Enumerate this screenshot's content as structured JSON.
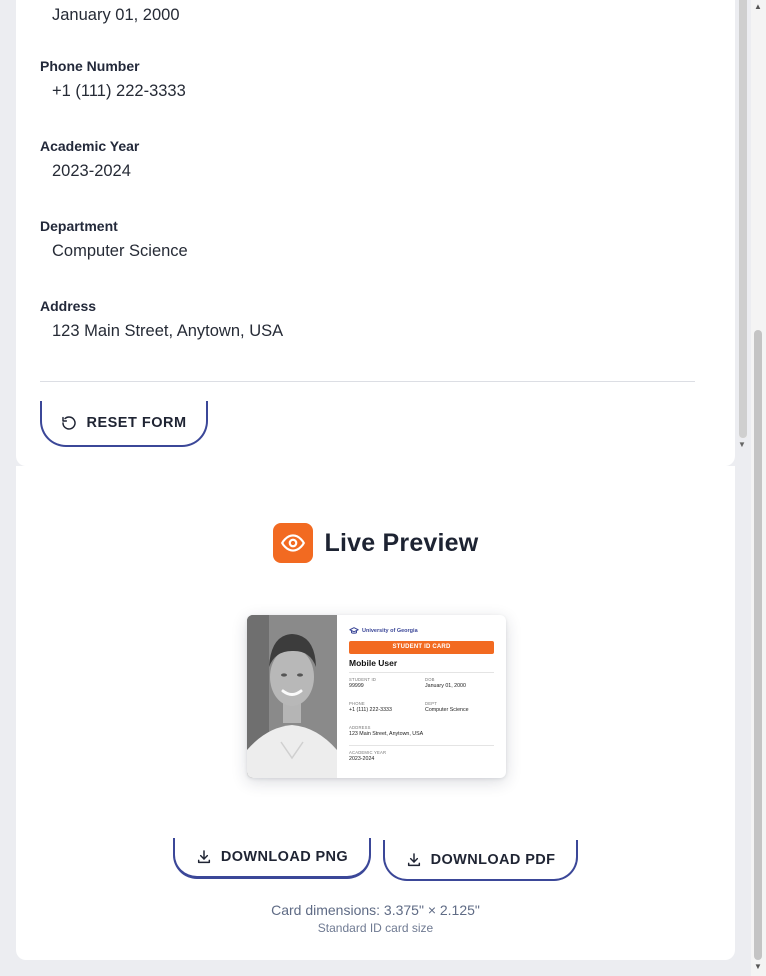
{
  "form": {
    "fields": [
      {
        "label": "",
        "value": "January 01, 2000"
      },
      {
        "label": "Phone Number",
        "value": "+1 (111) 222-3333"
      },
      {
        "label": "Academic Year",
        "value": "2023-2024"
      },
      {
        "label": "Department",
        "value": "Computer Science"
      },
      {
        "label": "Address",
        "value": "123 Main Street, Anytown, USA"
      }
    ],
    "reset_label": "RESET FORM"
  },
  "preview": {
    "title": "Live Preview",
    "card": {
      "university": "University of Georgia",
      "banner": "STUDENT ID CARD",
      "name": "Mobile User",
      "student_id_label": "STUDENT ID",
      "student_id": "99999",
      "dob_label": "DOB",
      "dob": "January 01, 2000",
      "phone_label": "PHONE",
      "phone": "+1 (111) 222-3333",
      "dept_label": "DEPT",
      "dept": "Computer Science",
      "address_label": "ADDRESS",
      "address": "123 Main Street, Anytown, USA",
      "year_label": "ACADEMIC YEAR",
      "year": "2023-2024"
    },
    "download_png_label": "DOWNLOAD PNG",
    "download_pdf_label": "DOWNLOAD PDF",
    "dimensions_text": "Card dimensions: 3.375\" × 2.125\"",
    "dimensions_subtext": "Standard ID card size"
  },
  "icons": {
    "reset": "rotate-ccw-icon",
    "preview": "eye-icon",
    "download": "download-icon",
    "university": "graduation-cap-icon"
  },
  "colors": {
    "accent": "#f26a21",
    "button_border": "#3b4798",
    "page_bg": "#ecedf1"
  }
}
